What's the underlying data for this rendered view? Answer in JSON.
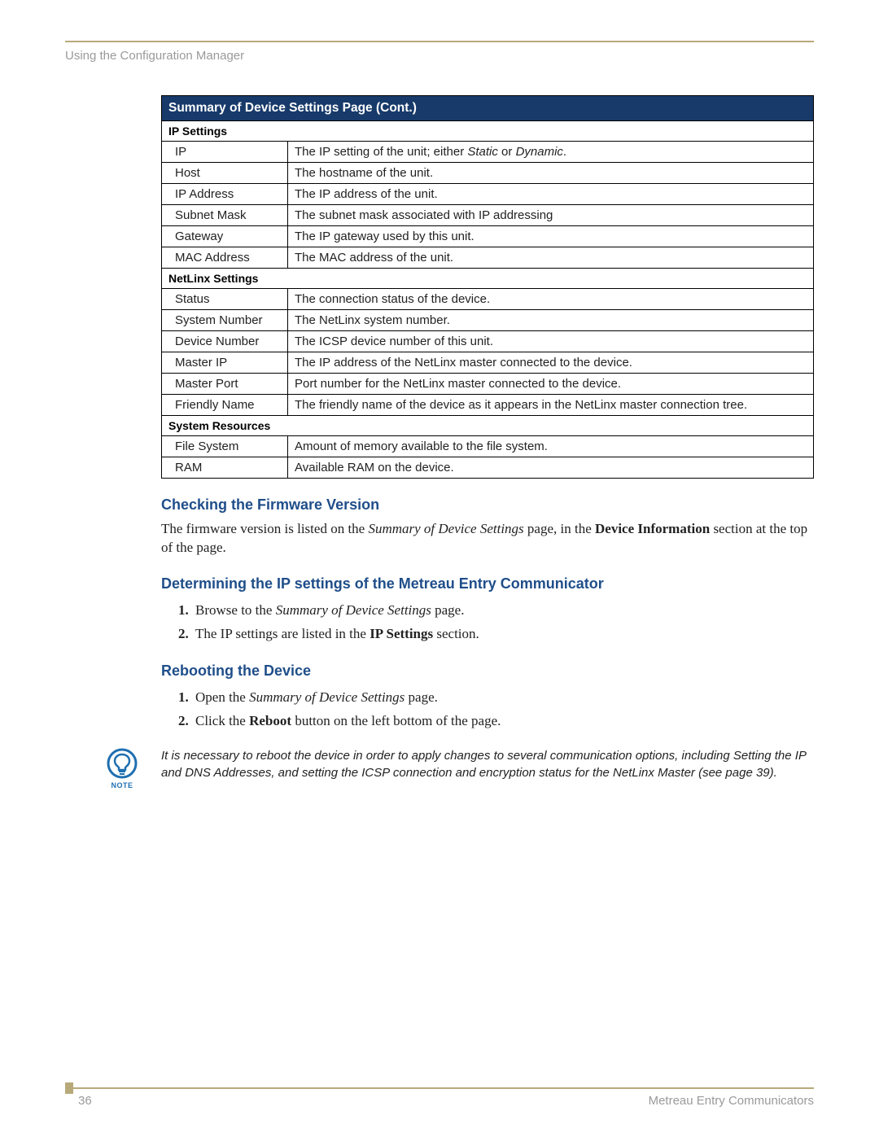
{
  "running_head": "Using the Configuration Manager",
  "table": {
    "title": "Summary of Device Settings Page (Cont.)",
    "sections": [
      {
        "name": "IP Settings",
        "rows": [
          {
            "label": "IP",
            "desc": "The IP setting of the unit; either <i>Static</i> or <i>Dynamic</i>."
          },
          {
            "label": "Host",
            "desc": "The hostname of the unit."
          },
          {
            "label": "IP Address",
            "desc": "The IP address of the unit."
          },
          {
            "label": "Subnet Mask",
            "desc": "The subnet mask associated with IP addressing"
          },
          {
            "label": "Gateway",
            "desc": "The IP gateway used by this unit."
          },
          {
            "label": "MAC Address",
            "desc": "The MAC address of the unit."
          }
        ]
      },
      {
        "name": "NetLinx Settings",
        "rows": [
          {
            "label": "Status",
            "desc": "The connection status of the device."
          },
          {
            "label": "System Number",
            "desc": "The NetLinx system number."
          },
          {
            "label": "Device Number",
            "desc": "The ICSP device number of this unit."
          },
          {
            "label": "Master IP",
            "desc": "The IP address of the NetLinx master connected to the device."
          },
          {
            "label": "Master Port",
            "desc": "Port number for the NetLinx master connected to the device."
          },
          {
            "label": "Friendly Name",
            "desc": "The friendly name of the device as it appears in the NetLinx master connection tree."
          }
        ]
      },
      {
        "name": "System Resources",
        "rows": [
          {
            "label": "File System",
            "desc": "Amount of memory available to the file system."
          },
          {
            "label": "RAM",
            "desc": "Available RAM on the device."
          }
        ]
      }
    ]
  },
  "h_firmware": "Checking the Firmware Version",
  "p_firmware": "The firmware version is listed on the <i>Summary of Device Settings</i> page, in the <b>Device Information</b> section at the top of the page.",
  "h_ip": "Determining the IP settings of the Metreau Entry Communicator",
  "ip_steps": [
    "Browse to the <i>Summary of Device Settings</i> page.",
    "The IP settings are listed in the <b>IP Settings</b> section."
  ],
  "h_reboot": "Rebooting the Device",
  "reboot_steps": [
    "Open the <i>Summary of Device Settings</i> page.",
    "Click the <b>Reboot</b> button on the left bottom of the page."
  ],
  "note_label": "NOTE",
  "note_text": "It is necessary to reboot the device in order to apply changes to several communication options, including Setting the IP and DNS Addresses, and setting the ICSP connection and encryption status for the NetLinx Master (see page 39).",
  "footer": {
    "page": "36",
    "doc": "Metreau Entry Communicators"
  }
}
